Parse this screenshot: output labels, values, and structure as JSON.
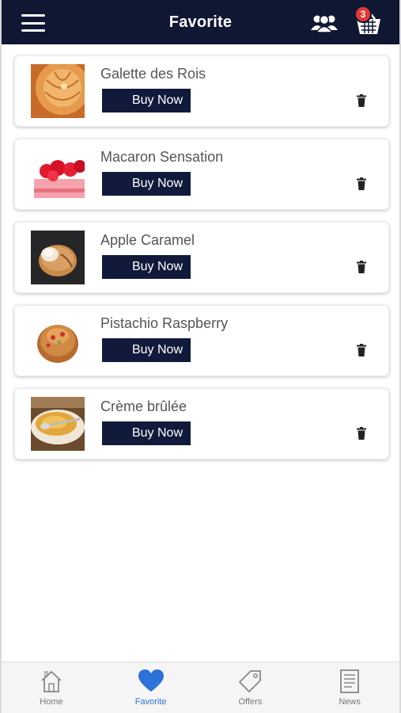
{
  "header": {
    "title": "Favorite",
    "menu_icon": "menu-icon",
    "users_icon": "users-icon",
    "cart_icon": "basket-icon",
    "cart_count": "3"
  },
  "favorites": [
    {
      "name": "Galette des Rois",
      "button": "Buy Now"
    },
    {
      "name": "Macaron Sensation",
      "button": "Buy Now"
    },
    {
      "name": "Apple Caramel",
      "button": "Buy Now"
    },
    {
      "name": "Pistachio Raspberry",
      "button": "Buy Now"
    },
    {
      "name": "Crème brûlée",
      "button": "Buy Now"
    }
  ],
  "bottom_nav": [
    {
      "label": "Home",
      "icon": "home-icon",
      "active": false
    },
    {
      "label": "Favorite",
      "icon": "heart-icon",
      "active": true
    },
    {
      "label": "Offers",
      "icon": "tag-icon",
      "active": false
    },
    {
      "label": "News",
      "icon": "news-icon",
      "active": false
    }
  ],
  "colors": {
    "header_bg": "#0f1733",
    "button_bg": "#111a3a",
    "badge": "#e53935",
    "active": "#2c72d8"
  }
}
